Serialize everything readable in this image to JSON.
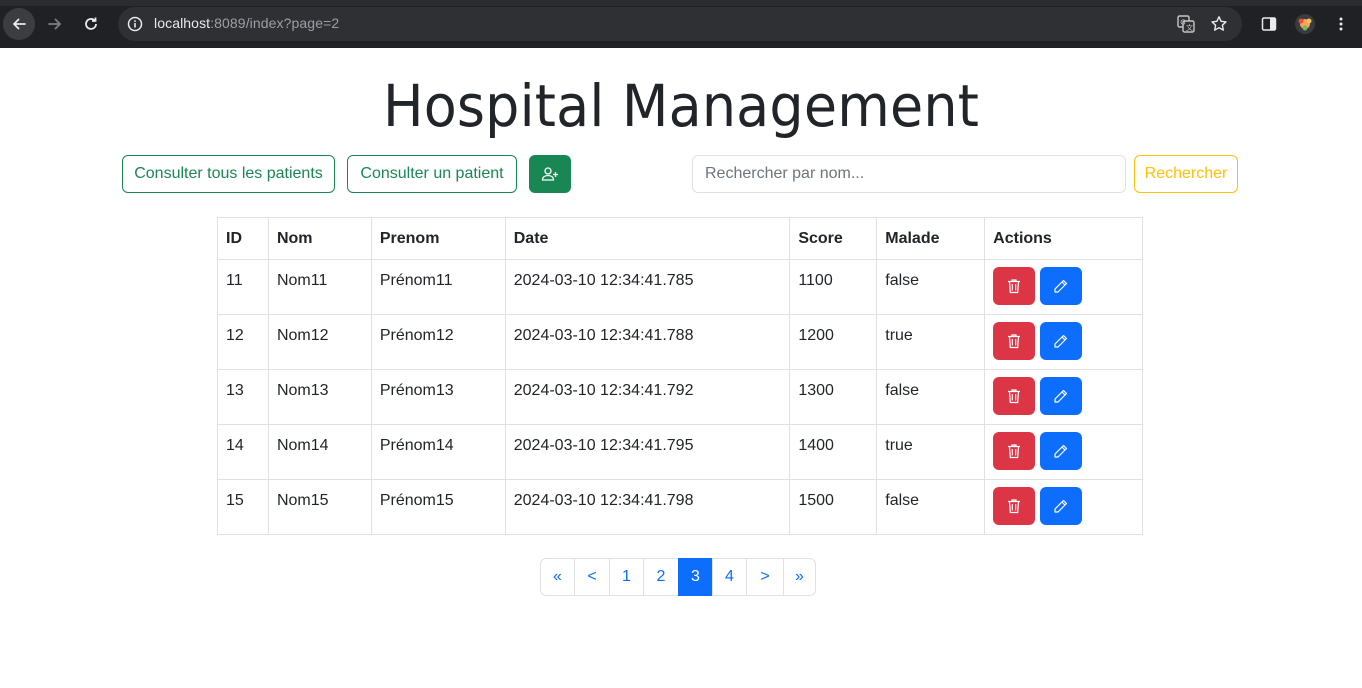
{
  "browser": {
    "url_host": "localhost",
    "url_rest": ":8089/index?page=2"
  },
  "page": {
    "title": "Hospital Management",
    "btn_all": "Consulter tous les patients",
    "btn_one": "Consulter un patient",
    "search_placeholder": "Rechercher par nom...",
    "search_btn": "Rechercher"
  },
  "table": {
    "headers": [
      "ID",
      "Nom",
      "Prenom",
      "Date",
      "Score",
      "Malade",
      "Actions"
    ],
    "rows": [
      [
        "11",
        "Nom11",
        "Prénom11",
        "2024-03-10 12:34:41.785",
        "1100",
        "false"
      ],
      [
        "12",
        "Nom12",
        "Prénom12",
        "2024-03-10 12:34:41.788",
        "1200",
        "true"
      ],
      [
        "13",
        "Nom13",
        "Prénom13",
        "2024-03-10 12:34:41.792",
        "1300",
        "false"
      ],
      [
        "14",
        "Nom14",
        "Prénom14",
        "2024-03-10 12:34:41.795",
        "1400",
        "true"
      ],
      [
        "15",
        "Nom15",
        "Prénom15",
        "2024-03-10 12:34:41.798",
        "1500",
        "false"
      ]
    ]
  },
  "pagination": {
    "items": [
      "«",
      "<",
      "1",
      "2",
      "3",
      "4",
      ">",
      "»"
    ],
    "active": "3"
  },
  "colors": {
    "success": "#198754",
    "danger": "#dc3545",
    "primary": "#0d6efd",
    "warning": "#ffc107"
  }
}
